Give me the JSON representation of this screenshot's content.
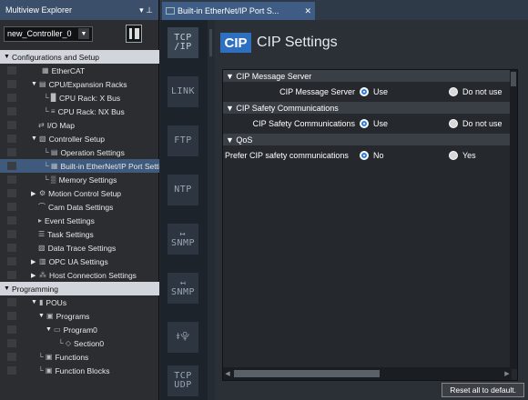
{
  "explorer": {
    "title": "Multiview Explorer",
    "pin": "▾  1",
    "controller": "new_Controller_0",
    "items": [
      {
        "label": "Configurations and Setup",
        "arrow": "▼",
        "section": true,
        "indent": 0
      },
      {
        "label": "EtherCAT",
        "icon": "▦",
        "indent": 16
      },
      {
        "label": "CPU/Expansion Racks",
        "arrow": "▼",
        "icon": "▤",
        "indent": 4
      },
      {
        "label": "CPU Rack: X Bus",
        "icon": "└ ▉",
        "indent": 18
      },
      {
        "label": "CPU Rack: NX Bus",
        "icon": "└ ≡",
        "indent": 18
      },
      {
        "label": "I/O Map",
        "icon": "⇄",
        "indent": 12
      },
      {
        "label": "Controller Setup",
        "arrow": "▼",
        "icon": "▧",
        "indent": 4
      },
      {
        "label": "Operation Settings",
        "icon": "└ ▤",
        "indent": 18
      },
      {
        "label": "Built-in EtherNet/IP Port Settings",
        "icon": "└ ▦",
        "indent": 18,
        "selected": true
      },
      {
        "label": "Memory Settings",
        "icon": "└ ▒",
        "indent": 18
      },
      {
        "label": "Motion Control Setup",
        "arrow": "▶",
        "icon": "⚙",
        "indent": 4
      },
      {
        "label": "Cam Data Settings",
        "icon": "⌒",
        "indent": 12
      },
      {
        "label": "Event Settings",
        "icon": "▸",
        "indent": 12
      },
      {
        "label": "Task Settings",
        "icon": "☰",
        "indent": 12
      },
      {
        "label": "Data Trace Settings",
        "icon": "▨",
        "indent": 12
      },
      {
        "label": "OPC UA Settings",
        "arrow": "▶",
        "icon": "▥",
        "indent": 4
      },
      {
        "label": "Host Connection Settings",
        "arrow": "▶",
        "icon": "⁂",
        "indent": 4
      },
      {
        "label": "Programming",
        "arrow": "▼",
        "section": true,
        "indent": 0
      },
      {
        "label": "POUs",
        "arrow": "▼",
        "icon": "▮",
        "indent": 4
      },
      {
        "label": "Programs",
        "arrow": "▼",
        "icon": "▣",
        "indent": 12
      },
      {
        "label": "Program0",
        "arrow": "▼",
        "icon": "▭",
        "indent": 20
      },
      {
        "label": "Section0",
        "icon": "└ ◇",
        "indent": 34
      },
      {
        "label": "Functions",
        "icon": "└ ▣",
        "indent": 12
      },
      {
        "label": "Function Blocks",
        "icon": "└ ▣",
        "indent": 12
      }
    ]
  },
  "tab": {
    "label": "Built-in EtherNet/IP Port S...",
    "close": "✕"
  },
  "rail": [
    {
      "label": "TCP\n/IP",
      "name": "tcpip-tab",
      "active": true
    },
    {
      "label": "LINK",
      "name": "link-tab"
    },
    {
      "label": "FTP",
      "name": "ftp-tab"
    },
    {
      "label": "NTP",
      "name": "ntp-tab"
    },
    {
      "label": "↦\nSNMP",
      "name": "snmp-tab"
    },
    {
      "label": "↤\nSNMP",
      "name": "snmp-trap-tab"
    },
    {
      "label": "⯒⯓",
      "name": "packet-filter-tab"
    },
    {
      "label": "TCP\nUDP",
      "name": "tcp-udp-tab"
    }
  ],
  "main": {
    "badge": "CIP",
    "title": "CIP Settings",
    "groups": [
      {
        "header": "▼ CIP Message Server",
        "settings": [
          {
            "label": "CIP Message Server",
            "opt1": "Use",
            "opt2": "Do not use",
            "selected": 1
          }
        ]
      },
      {
        "header": "▼ CIP Safety Communications",
        "settings": [
          {
            "label": "CIP Safety Communications",
            "opt1": "Use",
            "opt2": "Do not use",
            "selected": 1
          }
        ]
      },
      {
        "header": "▼ QoS",
        "settings": [
          {
            "label": "Prefer CIP safety communications",
            "opt1": "No",
            "opt2": "Yes",
            "selected": 1,
            "leftLabel": true
          }
        ]
      }
    ],
    "reset": "Reset all to default."
  }
}
